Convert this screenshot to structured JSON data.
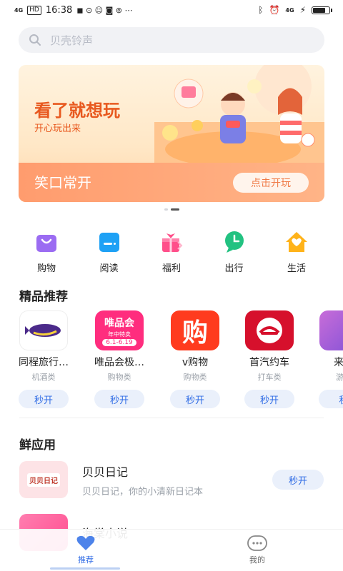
{
  "status_bar": {
    "network": "4G",
    "hd": "HD",
    "time": "16:38",
    "signal_right": "4G",
    "battery_level": 0.85
  },
  "search": {
    "placeholder": "贝壳铃声"
  },
  "banner": {
    "title": "看了就想玩",
    "subtitle": "开心玩出来",
    "caption": "笑口常开",
    "cta": "点击开玩"
  },
  "categories": [
    {
      "label": "购物",
      "icon": "shopping-bag-icon"
    },
    {
      "label": "阅读",
      "icon": "book-icon"
    },
    {
      "label": "福利",
      "icon": "gift-icon"
    },
    {
      "label": "出行",
      "icon": "location-pin-icon"
    },
    {
      "label": "生活",
      "icon": "house-icon"
    }
  ],
  "featured": {
    "title": "精品推荐",
    "apps": [
      {
        "name": "同程旅行…",
        "category": "机酒类",
        "button": "秒开"
      },
      {
        "name": "唯品会极…",
        "category": "购物类",
        "button": "秒开",
        "icon_text": "唯品会",
        "icon_sub": "年中特卖",
        "icon_date": "6.1-6.19"
      },
      {
        "name": "v购物",
        "category": "购物类",
        "button": "秒开",
        "icon_text": "购"
      },
      {
        "name": "首汽约车",
        "category": "打车类",
        "button": "秒开"
      },
      {
        "name": "来切",
        "category": "游戏",
        "button": "秒"
      }
    ]
  },
  "fresh": {
    "title": "鲜应用",
    "apps": [
      {
        "name": "贝贝日记",
        "desc": "贝贝日记，你的小清新日记本",
        "button": "秒开",
        "icon_text": "贝贝日记"
      },
      {
        "name": "海棠小说",
        "desc": "",
        "button": ""
      }
    ]
  },
  "tabs": [
    {
      "label": "推荐",
      "active": true
    },
    {
      "label": "我的",
      "active": false
    }
  ],
  "colors": {
    "accent": "#2f6be5",
    "banner_orange": "#e8591f"
  }
}
